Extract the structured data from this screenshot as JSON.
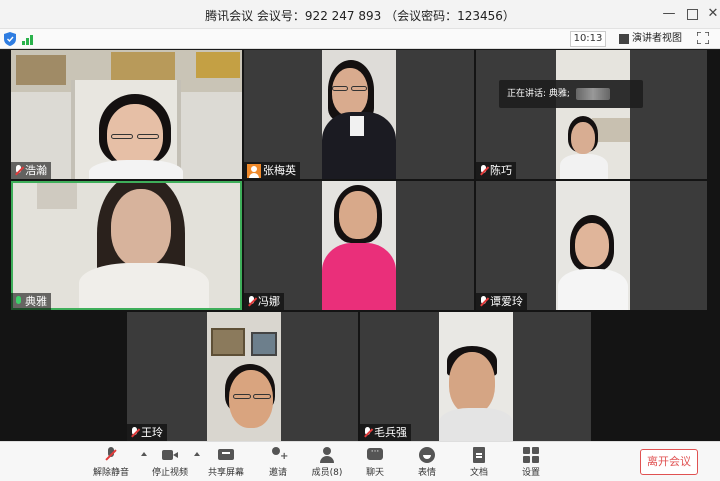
{
  "title": "腾讯会议 会议号：922 247 893 （会议密码：123456）",
  "clock": "10:13",
  "speaker_view_label": "演讲者视图",
  "speaking_banner": "正在讲话: 典雅;",
  "participants": [
    {
      "name": "浩瀚",
      "mic": "muted"
    },
    {
      "name": "张梅英",
      "mic": "user"
    },
    {
      "name": "陈巧",
      "mic": "muted"
    },
    {
      "name": "典雅",
      "mic": "active"
    },
    {
      "name": "冯娜",
      "mic": "muted"
    },
    {
      "name": "谭爱玲",
      "mic": "muted"
    },
    {
      "name": "王玲",
      "mic": "muted"
    },
    {
      "name": "毛兵强",
      "mic": "muted"
    }
  ],
  "toolbar": {
    "unmute": "解除静音",
    "stop_video": "停止视频",
    "share_screen": "共享屏幕",
    "invite": "邀请",
    "members": "成员(8)",
    "chat": "聊天",
    "emoji": "表情",
    "docs": "文档",
    "settings": "设置",
    "leave": "离开会议"
  },
  "colors": {
    "active_speaker": "#3fae5a",
    "leave": "#e05252",
    "muted_slash": "#e23b3b"
  }
}
